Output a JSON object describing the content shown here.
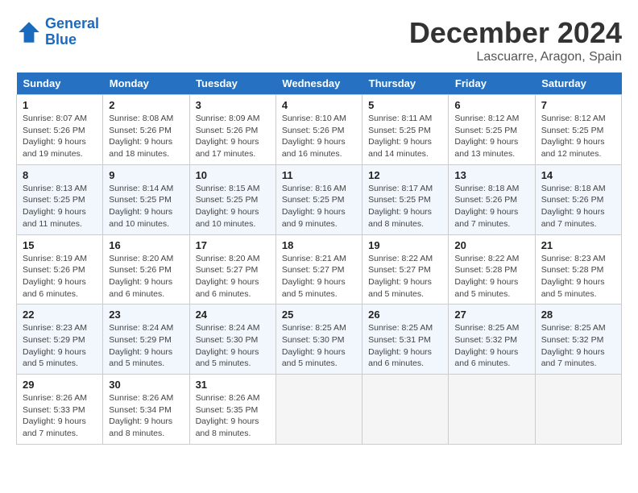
{
  "logo": {
    "line1": "General",
    "line2": "Blue"
  },
  "title": "December 2024",
  "location": "Lascuarre, Aragon, Spain",
  "days_of_week": [
    "Sunday",
    "Monday",
    "Tuesday",
    "Wednesday",
    "Thursday",
    "Friday",
    "Saturday"
  ],
  "weeks": [
    [
      {
        "day": "1",
        "info": "Sunrise: 8:07 AM\nSunset: 5:26 PM\nDaylight: 9 hours\nand 19 minutes."
      },
      {
        "day": "2",
        "info": "Sunrise: 8:08 AM\nSunset: 5:26 PM\nDaylight: 9 hours\nand 18 minutes."
      },
      {
        "day": "3",
        "info": "Sunrise: 8:09 AM\nSunset: 5:26 PM\nDaylight: 9 hours\nand 17 minutes."
      },
      {
        "day": "4",
        "info": "Sunrise: 8:10 AM\nSunset: 5:26 PM\nDaylight: 9 hours\nand 16 minutes."
      },
      {
        "day": "5",
        "info": "Sunrise: 8:11 AM\nSunset: 5:25 PM\nDaylight: 9 hours\nand 14 minutes."
      },
      {
        "day": "6",
        "info": "Sunrise: 8:12 AM\nSunset: 5:25 PM\nDaylight: 9 hours\nand 13 minutes."
      },
      {
        "day": "7",
        "info": "Sunrise: 8:12 AM\nSunset: 5:25 PM\nDaylight: 9 hours\nand 12 minutes."
      }
    ],
    [
      {
        "day": "8",
        "info": "Sunrise: 8:13 AM\nSunset: 5:25 PM\nDaylight: 9 hours\nand 11 minutes."
      },
      {
        "day": "9",
        "info": "Sunrise: 8:14 AM\nSunset: 5:25 PM\nDaylight: 9 hours\nand 10 minutes."
      },
      {
        "day": "10",
        "info": "Sunrise: 8:15 AM\nSunset: 5:25 PM\nDaylight: 9 hours\nand 10 minutes."
      },
      {
        "day": "11",
        "info": "Sunrise: 8:16 AM\nSunset: 5:25 PM\nDaylight: 9 hours\nand 9 minutes."
      },
      {
        "day": "12",
        "info": "Sunrise: 8:17 AM\nSunset: 5:25 PM\nDaylight: 9 hours\nand 8 minutes."
      },
      {
        "day": "13",
        "info": "Sunrise: 8:18 AM\nSunset: 5:26 PM\nDaylight: 9 hours\nand 7 minutes."
      },
      {
        "day": "14",
        "info": "Sunrise: 8:18 AM\nSunset: 5:26 PM\nDaylight: 9 hours\nand 7 minutes."
      }
    ],
    [
      {
        "day": "15",
        "info": "Sunrise: 8:19 AM\nSunset: 5:26 PM\nDaylight: 9 hours\nand 6 minutes."
      },
      {
        "day": "16",
        "info": "Sunrise: 8:20 AM\nSunset: 5:26 PM\nDaylight: 9 hours\nand 6 minutes."
      },
      {
        "day": "17",
        "info": "Sunrise: 8:20 AM\nSunset: 5:27 PM\nDaylight: 9 hours\nand 6 minutes."
      },
      {
        "day": "18",
        "info": "Sunrise: 8:21 AM\nSunset: 5:27 PM\nDaylight: 9 hours\nand 5 minutes."
      },
      {
        "day": "19",
        "info": "Sunrise: 8:22 AM\nSunset: 5:27 PM\nDaylight: 9 hours\nand 5 minutes."
      },
      {
        "day": "20",
        "info": "Sunrise: 8:22 AM\nSunset: 5:28 PM\nDaylight: 9 hours\nand 5 minutes."
      },
      {
        "day": "21",
        "info": "Sunrise: 8:23 AM\nSunset: 5:28 PM\nDaylight: 9 hours\nand 5 minutes."
      }
    ],
    [
      {
        "day": "22",
        "info": "Sunrise: 8:23 AM\nSunset: 5:29 PM\nDaylight: 9 hours\nand 5 minutes."
      },
      {
        "day": "23",
        "info": "Sunrise: 8:24 AM\nSunset: 5:29 PM\nDaylight: 9 hours\nand 5 minutes."
      },
      {
        "day": "24",
        "info": "Sunrise: 8:24 AM\nSunset: 5:30 PM\nDaylight: 9 hours\nand 5 minutes."
      },
      {
        "day": "25",
        "info": "Sunrise: 8:25 AM\nSunset: 5:30 PM\nDaylight: 9 hours\nand 5 minutes."
      },
      {
        "day": "26",
        "info": "Sunrise: 8:25 AM\nSunset: 5:31 PM\nDaylight: 9 hours\nand 6 minutes."
      },
      {
        "day": "27",
        "info": "Sunrise: 8:25 AM\nSunset: 5:32 PM\nDaylight: 9 hours\nand 6 minutes."
      },
      {
        "day": "28",
        "info": "Sunrise: 8:25 AM\nSunset: 5:32 PM\nDaylight: 9 hours\nand 7 minutes."
      }
    ],
    [
      {
        "day": "29",
        "info": "Sunrise: 8:26 AM\nSunset: 5:33 PM\nDaylight: 9 hours\nand 7 minutes."
      },
      {
        "day": "30",
        "info": "Sunrise: 8:26 AM\nSunset: 5:34 PM\nDaylight: 9 hours\nand 8 minutes."
      },
      {
        "day": "31",
        "info": "Sunrise: 8:26 AM\nSunset: 5:35 PM\nDaylight: 9 hours\nand 8 minutes."
      },
      {
        "day": "",
        "info": ""
      },
      {
        "day": "",
        "info": ""
      },
      {
        "day": "",
        "info": ""
      },
      {
        "day": "",
        "info": ""
      }
    ]
  ]
}
